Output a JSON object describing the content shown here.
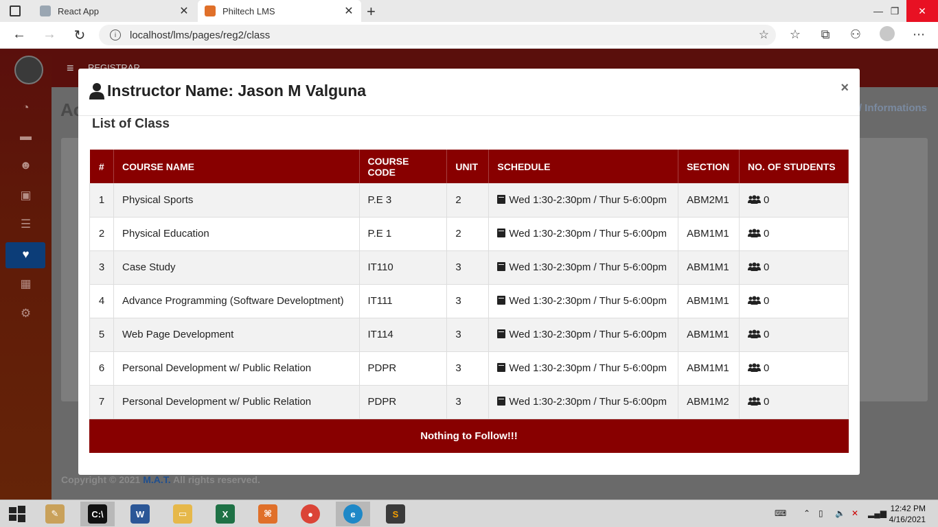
{
  "browser": {
    "tabs": [
      {
        "label": "React App",
        "favicon": "react-favicon",
        "color": "#9aa6b2"
      },
      {
        "label": "Philtech LMS",
        "favicon": "philtech-favicon",
        "color": "#e0702a"
      }
    ],
    "url": "localhost/lms/pages/reg2/class"
  },
  "app": {
    "header_label": "REGISTRAR",
    "page_title": "Ac",
    "breadcrumb": "/ Informations",
    "footer": {
      "prefix": "Copyright © 2021 ",
      "brand": "M.A.T.",
      "suffix": " All rights reserved."
    }
  },
  "modal": {
    "title": "Instructor Name: Jason M Valguna",
    "close_label": "×",
    "subtitle": "List of Class",
    "columns": [
      "#",
      "COURSE NAME",
      "COURSE CODE",
      "UNIT",
      "SCHEDULE",
      "SECTION",
      "NO. OF STUDENTS"
    ],
    "rows": [
      {
        "no": "1",
        "name": "Physical Sports",
        "code": "P.E 3",
        "unit": "2",
        "schedule": "Wed 1:30-2:30pm / Thur 5-6:00pm",
        "section": "ABM2M1",
        "students": "0"
      },
      {
        "no": "2",
        "name": "Physical Education",
        "code": "P.E 1",
        "unit": "2",
        "schedule": "Wed 1:30-2:30pm / Thur 5-6:00pm",
        "section": "ABM1M1",
        "students": "0"
      },
      {
        "no": "3",
        "name": "Case Study",
        "code": "IT110",
        "unit": "3",
        "schedule": "Wed 1:30-2:30pm / Thur 5-6:00pm",
        "section": "ABM1M1",
        "students": "0"
      },
      {
        "no": "4",
        "name": "Advance Programming (Software Developtment)",
        "code": "IT111",
        "unit": "3",
        "schedule": "Wed 1:30-2:30pm / Thur 5-6:00pm",
        "section": "ABM1M1",
        "students": "0"
      },
      {
        "no": "5",
        "name": "Web Page Development",
        "code": "IT114",
        "unit": "3",
        "schedule": "Wed 1:30-2:30pm / Thur 5-6:00pm",
        "section": "ABM1M1",
        "students": "0"
      },
      {
        "no": "6",
        "name": "Personal Development w/ Public Relation",
        "code": "PDPR",
        "unit": "3",
        "schedule": "Wed 1:30-2:30pm / Thur 5-6:00pm",
        "section": "ABM1M1",
        "students": "0"
      },
      {
        "no": "7",
        "name": "Personal Development w/ Public Relation",
        "code": "PDPR",
        "unit": "3",
        "schedule": "Wed 1:30-2:30pm / Thur 5-6:00pm",
        "section": "ABM1M2",
        "students": "0"
      }
    ],
    "footer_note": "Nothing to Follow!!!"
  },
  "taskbar": {
    "time": "12:42 PM",
    "date": "4/16/2021"
  },
  "colors": {
    "table_header": "#880000",
    "sidebar": "#5a0f0c",
    "sidebar_active": "#0c3d78"
  }
}
